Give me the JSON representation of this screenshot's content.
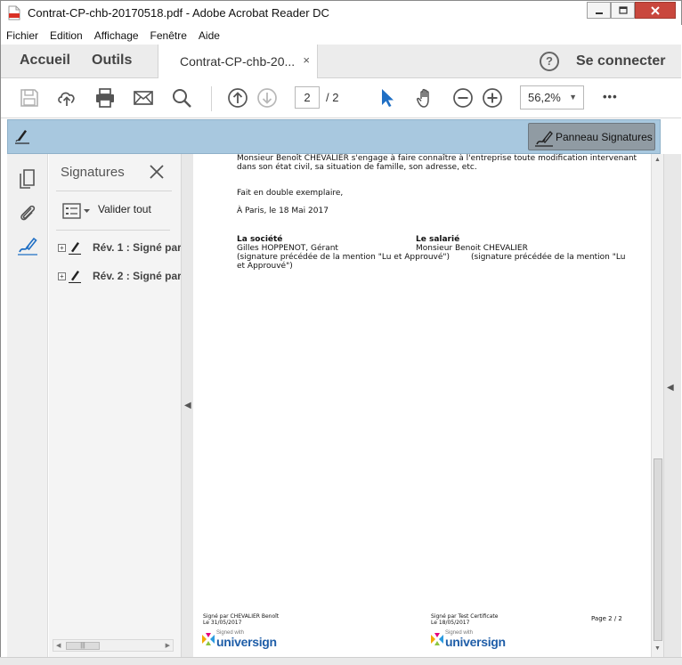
{
  "window": {
    "title": "Contrat-CP-chb-20170518.pdf - Adobe Acrobat Reader DC",
    "minimize": "0",
    "maximize": "1",
    "close": "r"
  },
  "menu": [
    "Fichier",
    "Edition",
    "Affichage",
    "Fenêtre",
    "Aide"
  ],
  "tabs": {
    "home": "Accueil",
    "tools": "Outils",
    "document": "Contrat-CP-chb-20...",
    "close": "×",
    "help": "?",
    "connect": "Se connecter"
  },
  "toolbar": {
    "page_current": "2",
    "page_total": "/ 2",
    "zoom": "56,2%",
    "zoom_caret": "▼",
    "more": "•••"
  },
  "sigbar": {
    "panel_button": "Panneau Signatures"
  },
  "sidepanel": {
    "title": "Signatures",
    "validate_all": "Valider tout",
    "revisions": [
      "Rév. 1 : Signé par",
      "Rév. 2 : Signé par"
    ],
    "expand": "+"
  },
  "document": {
    "line1": "Monsieur Benoît CHEVALIER s'engage à faire connaître à l'entreprise toute modification  intervenant",
    "line2": "dans son état civil, sa situation de famille, son adresse, etc.",
    "double": "Fait en double exemplaire,",
    "place_date": "À Paris, le 18 Mai 2017",
    "company_heading": "La société",
    "employee_heading": "Le salarié",
    "company_signer": "Gilles HOPPENOT, Gérant",
    "employee_signer": "Monsieur Benoit CHEVALIER",
    "company_mention": "(signature précédée de la mention \"Lu et Approuvé\")",
    "company_mention2": "et Approuvé\")",
    "employee_mention": "(signature précédée de la mention \"Lu",
    "footer_left_1": "Signé par CHEVALIER Benoît",
    "footer_left_2": "Le 31/05/2017",
    "footer_mid_1": "Signé par Test Certificate",
    "footer_mid_2": "Le 18/05/2017",
    "page_label": "Page 2 / 2",
    "logo_small": "Signed with",
    "logo_name": "universign"
  },
  "colors": {
    "sigbar": "#a8c8df",
    "accent_blue": "#1f6fc4",
    "universign_blue": "#1f5ea8",
    "close_red": "#c9473d"
  },
  "icons": {
    "titlebar": "pdf-file-icon",
    "save": "save-icon",
    "upload": "cloud-upload-icon",
    "print": "printer-icon",
    "email": "envelope-icon",
    "search": "magnifier-icon",
    "prev_page": "arrow-up-circle-icon",
    "next_page": "arrow-down-circle-icon",
    "select": "pointer-arrow-icon",
    "hand": "hand-icon",
    "zoom_out": "minus-circle-icon",
    "zoom_in": "plus-circle-icon",
    "pages": "pages-icon",
    "attach": "paperclip-icon",
    "signature": "signature-pen-icon"
  }
}
